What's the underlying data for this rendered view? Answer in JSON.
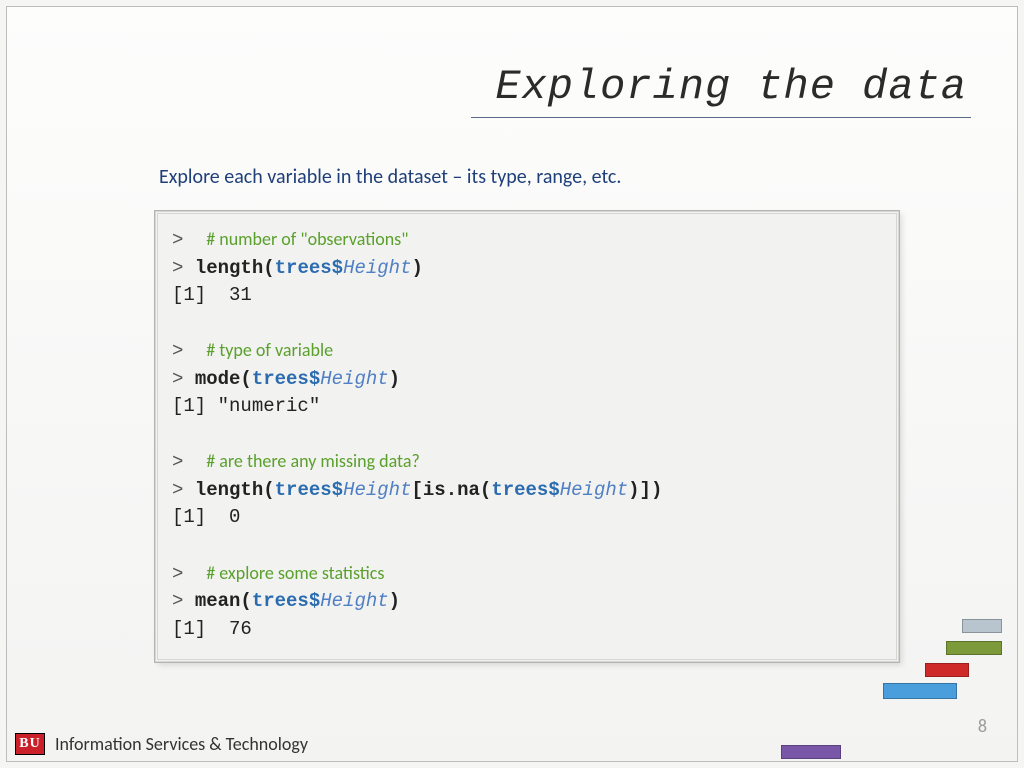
{
  "title": "Exploring the data",
  "subtitle": "Explore each variable in the dataset – its type, range, etc.",
  "code": {
    "c1": "# number of \"observations\"",
    "l1_fn": "length(",
    "l1_obj": "trees",
    "l1_dol": "$",
    "l1_fld": "Height",
    "l1_close": ")",
    "o1": "[1]  31",
    "c2": "# type of variable",
    "l2_fn": "mode(",
    "l2_obj": "trees",
    "l2_dol": "$",
    "l2_fld": "Height",
    "l2_close": ")",
    "o2": "[1] \"numeric\"",
    "c3": "# are there any missing data?",
    "l3_fn": "length(",
    "l3_obj": "trees",
    "l3_dol": "$",
    "l3_fld": "Height",
    "l3_mid": "[is.na(",
    "l3_obj2": "trees",
    "l3_dol2": "$",
    "l3_fld2": "Height",
    "l3_close": ")])",
    "o3": "[1]  0",
    "c4": "# explore some statistics",
    "l4_fn": "mean(",
    "l4_obj": "trees",
    "l4_dol": "$",
    "l4_fld": "Height",
    "l4_close": ")",
    "o4": "[1]  76"
  },
  "footer": {
    "logo": "BU",
    "text": "Information Services & Technology"
  },
  "page": "8"
}
